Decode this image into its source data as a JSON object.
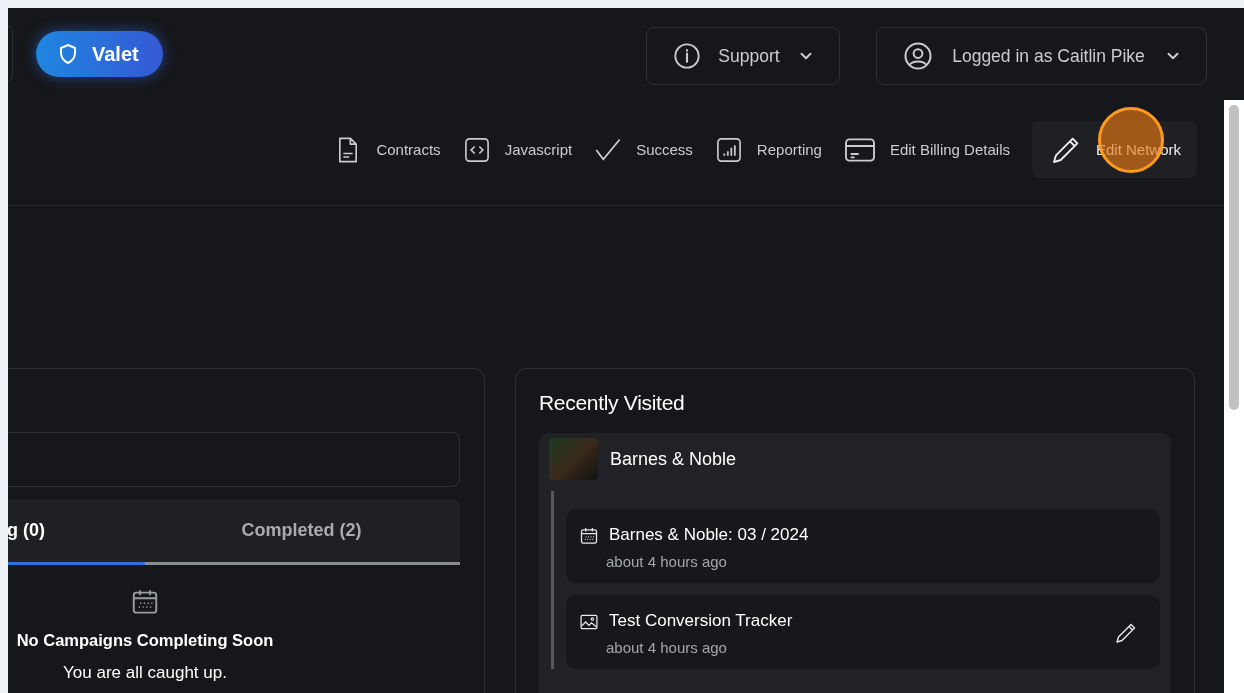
{
  "header": {
    "valet_button": {
      "label": "Valet"
    },
    "support_menu": {
      "label": "Support"
    },
    "account_menu": {
      "label": "Logged in as Caitlin Pike"
    }
  },
  "nav": [
    {
      "label": "Contracts",
      "selected": false
    },
    {
      "label": "Javascript",
      "selected": false
    },
    {
      "label": "Success",
      "selected": false
    },
    {
      "label": "Reporting",
      "selected": false
    },
    {
      "label": "Edit Billing Details",
      "selected": false
    },
    {
      "label": "Edit Network",
      "selected": true
    }
  ],
  "campaigns": {
    "tabs": [
      {
        "label": "g (0)",
        "selected": true
      },
      {
        "label": "Completed (2)",
        "selected": false
      }
    ],
    "empty_state": {
      "title": "No Campaigns Completing Soon",
      "message": "You are all caught up."
    }
  },
  "recently_visited": {
    "title": "Recently Visited",
    "groups": [
      {
        "name": "Barnes & Noble",
        "items": [
          {
            "kind": "campaign",
            "title": "Barnes & Noble: 03 / 2024",
            "time": "about 4 hours ago",
            "editable": false
          },
          {
            "kind": "creative",
            "title": "Test Conversion Tracker",
            "time": "about 4 hours ago",
            "editable": true
          }
        ]
      }
    ]
  }
}
